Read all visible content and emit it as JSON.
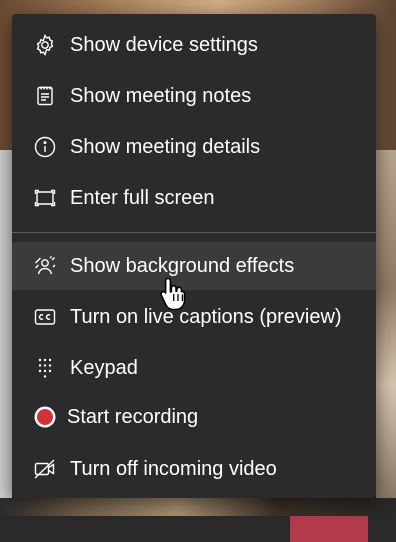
{
  "menu": {
    "items": [
      {
        "label": "Show device settings",
        "icon": "gear-icon"
      },
      {
        "label": "Show meeting notes",
        "icon": "notes-icon"
      },
      {
        "label": "Show meeting details",
        "icon": "info-icon"
      },
      {
        "label": "Enter full screen",
        "icon": "fullscreen-icon"
      },
      {
        "label": "Show background effects",
        "icon": "background-effects-icon"
      },
      {
        "label": "Turn on live captions (preview)",
        "icon": "captions-icon"
      },
      {
        "label": "Keypad",
        "icon": "keypad-icon"
      },
      {
        "label": "Start recording",
        "icon": "record-icon"
      },
      {
        "label": "Turn off incoming video",
        "icon": "video-off-icon"
      }
    ],
    "hovered_item": "Show background effects"
  },
  "colors": {
    "menu_bg": "#2b2b2b",
    "hover_bg": "#3b3b3b",
    "record_red": "#d13438",
    "end_call_red": "#b33a4a"
  }
}
